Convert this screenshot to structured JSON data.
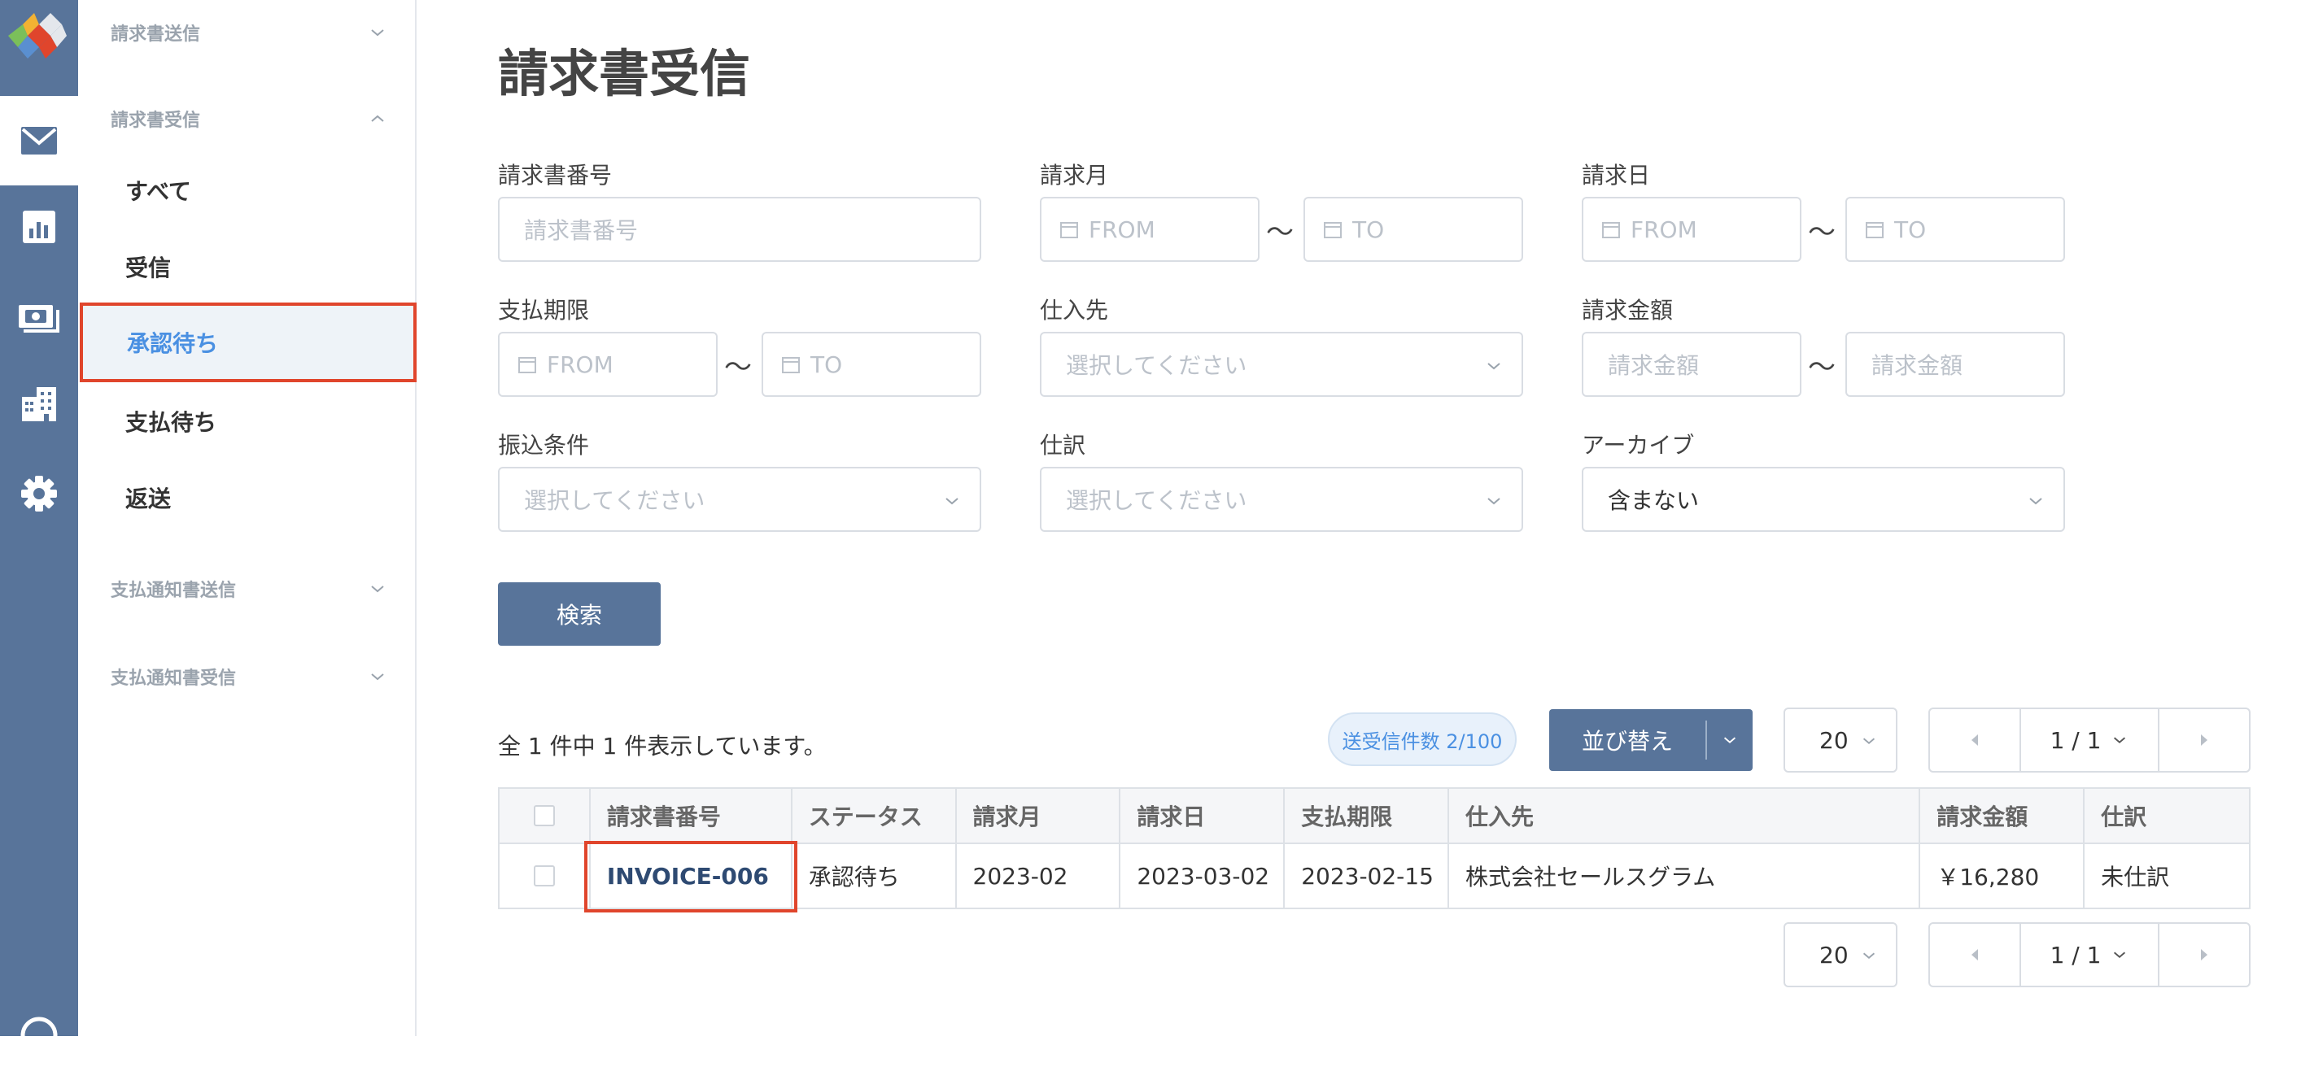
{
  "rail": {
    "items": [
      {
        "icon": "mail-icon",
        "active": true
      },
      {
        "icon": "bar-chart-icon",
        "active": false
      },
      {
        "icon": "money-icon",
        "active": false
      },
      {
        "icon": "building-icon",
        "active": false
      },
      {
        "icon": "gear-icon",
        "active": false
      },
      {
        "icon": "help-icon",
        "active": false
      }
    ]
  },
  "sidebar": {
    "group_send": "請求書送信",
    "group_receive": "請求書受信",
    "items": [
      "すべて",
      "受信",
      "承認待ち",
      "支払待ち",
      "返送"
    ],
    "active_item": "承認待ち",
    "group_payment_send": "支払通知書送信",
    "group_payment_receive": "支払通知書受信"
  },
  "page": {
    "title": "請求書受信"
  },
  "filters": {
    "invoice_number": {
      "label": "請求書番号",
      "placeholder": "請求書番号"
    },
    "billing_month": {
      "label": "請求月",
      "from": "FROM",
      "to": "TO"
    },
    "billing_date": {
      "label": "請求日",
      "from": "FROM",
      "to": "TO"
    },
    "due_date": {
      "label": "支払期限",
      "from": "FROM",
      "to": "TO"
    },
    "supplier": {
      "label": "仕入先",
      "placeholder": "選択してください"
    },
    "amount": {
      "label": "請求金額",
      "from_placeholder": "請求金額",
      "to_placeholder": "請求金額"
    },
    "transfer_terms": {
      "label": "振込条件",
      "placeholder": "選択してください"
    },
    "journal": {
      "label": "仕訳",
      "placeholder": "選択してください"
    },
    "archive": {
      "label": "アーカイブ",
      "value": "含まない"
    },
    "range_separator": "〜",
    "search_button": "検索"
  },
  "results": {
    "summary": "全 1 件中 1 件表示しています。",
    "quota_badge": "送受信件数 2/100",
    "sort_button": "並び替え",
    "page_size": "20",
    "page_indicator": "1 / 1"
  },
  "table": {
    "columns": [
      "請求書番号",
      "ステータス",
      "請求月",
      "請求日",
      "支払期限",
      "仕入先",
      "請求金額",
      "仕訳"
    ],
    "rows": [
      {
        "invoice_number": "INVOICE-006",
        "status": "承認待ち",
        "billing_month": "2023-02",
        "billing_date": "2023-03-02",
        "due_date": "2023-02-15",
        "supplier": "株式会社セールスグラム",
        "amount": "￥16,280",
        "journal": "未仕訳"
      }
    ]
  },
  "colors": {
    "rail_bg": "#58749a",
    "primary_button": "#58749a",
    "active_text": "#4a90e2",
    "highlight_border": "#e0452c"
  }
}
